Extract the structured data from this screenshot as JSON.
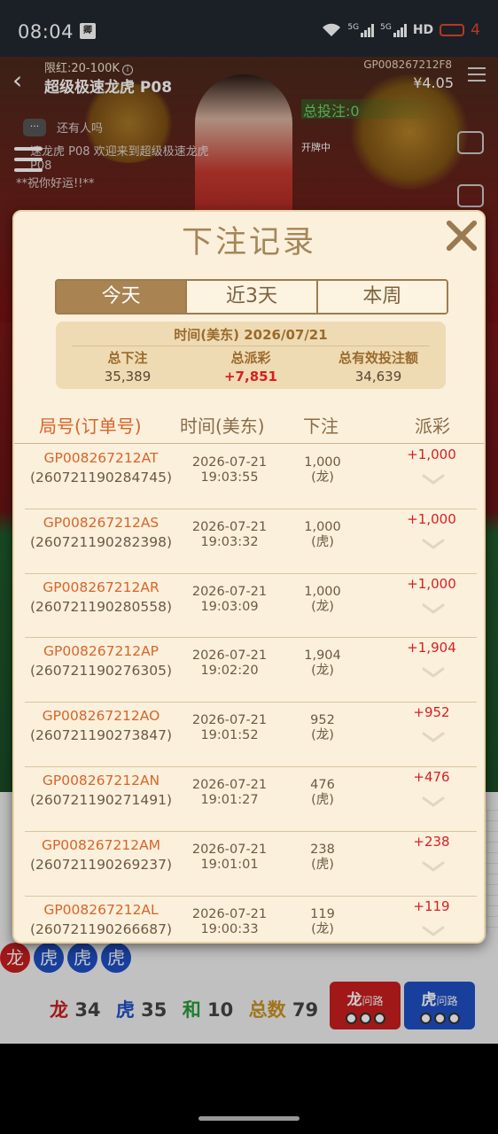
{
  "status_bar": {
    "time": "08:04",
    "app_badge": "卿",
    "net_label_1": "5G",
    "net_label_2": "5G",
    "hd_label": "HD",
    "battery": "4"
  },
  "game": {
    "limit": "限红:20-100K",
    "table_name": "超级极速龙虎 P08",
    "round_id": "GP008267212F8",
    "balance": "¥4.05",
    "total_bet": "总投注:0",
    "chat_count": "···",
    "chat_line1": "还有人吗",
    "chat_line2": "速龙虎 P08 欢迎来到超级极速龙虎 P08",
    "chat_line3": "**祝你好运!!**",
    "dealer_status": "开牌中",
    "stats": {
      "dragon_label": "龙",
      "dragon": "34",
      "tiger_label": "虎",
      "tiger": "35",
      "tie_label": "和",
      "tie": "10",
      "total_label": "总数",
      "total": "79"
    },
    "road_buttons": [
      {
        "label": "龙",
        "sub": "问路"
      },
      {
        "label": "虎",
        "sub": "问路"
      }
    ],
    "beads": [
      "龙",
      "虎",
      "虎",
      "虎"
    ]
  },
  "modal": {
    "title": "下注记录",
    "tabs": [
      "今天",
      "近3天",
      "本周"
    ],
    "active_tab": 0,
    "summary": {
      "date_label": "时间(美东) 2026/07/21",
      "total_bet_label": "总下注",
      "total_bet": "35,389",
      "total_payout_label": "总派彩",
      "total_payout": "+7,851",
      "valid_bet_label": "总有效投注额",
      "valid_bet": "34,639"
    },
    "columns": [
      "局号(订单号)",
      "时间(美东)",
      "下注",
      "派彩"
    ],
    "records": [
      {
        "round": "GP008267212AT",
        "order": "(260721190284745)",
        "date": "2026-07-21",
        "time": "19:03:55",
        "amount": "1,000",
        "side": "(龙)",
        "payout": "+1,000"
      },
      {
        "round": "GP008267212AS",
        "order": "(260721190282398)",
        "date": "2026-07-21",
        "time": "19:03:32",
        "amount": "1,000",
        "side": "(虎)",
        "payout": "+1,000"
      },
      {
        "round": "GP008267212AR",
        "order": "(260721190280558)",
        "date": "2026-07-21",
        "time": "19:03:09",
        "amount": "1,000",
        "side": "(龙)",
        "payout": "+1,000"
      },
      {
        "round": "GP008267212AP",
        "order": "(260721190276305)",
        "date": "2026-07-21",
        "time": "19:02:20",
        "amount": "1,904",
        "side": "(龙)",
        "payout": "+1,904"
      },
      {
        "round": "GP008267212AO",
        "order": "(260721190273847)",
        "date": "2026-07-21",
        "time": "19:01:52",
        "amount": "952",
        "side": "(龙)",
        "payout": "+952"
      },
      {
        "round": "GP008267212AN",
        "order": "(260721190271491)",
        "date": "2026-07-21",
        "time": "19:01:27",
        "amount": "476",
        "side": "(虎)",
        "payout": "+476"
      },
      {
        "round": "GP008267212AM",
        "order": "(260721190269237)",
        "date": "2026-07-21",
        "time": "19:01:01",
        "amount": "238",
        "side": "(虎)",
        "payout": "+238"
      },
      {
        "round": "GP008267212AL",
        "order": "(260721190266687)",
        "date": "2026-07-21",
        "time": "19:00:33",
        "amount": "119",
        "side": "(龙)",
        "payout": "+119"
      }
    ]
  },
  "colors": {
    "accent": "#a98351",
    "order_id": "#d7652a",
    "payout": "#d81f1f",
    "dragon": "#c81e1e",
    "tiger": "#1f4fc4",
    "tie": "#2a9a3a"
  },
  "icons": [
    "wifi-icon",
    "signal-icon",
    "battery-icon",
    "back-icon",
    "info-icon",
    "menu-icon",
    "chat-icon",
    "hamburger-icon",
    "video-icon",
    "close-icon",
    "chevron-down-icon"
  ]
}
